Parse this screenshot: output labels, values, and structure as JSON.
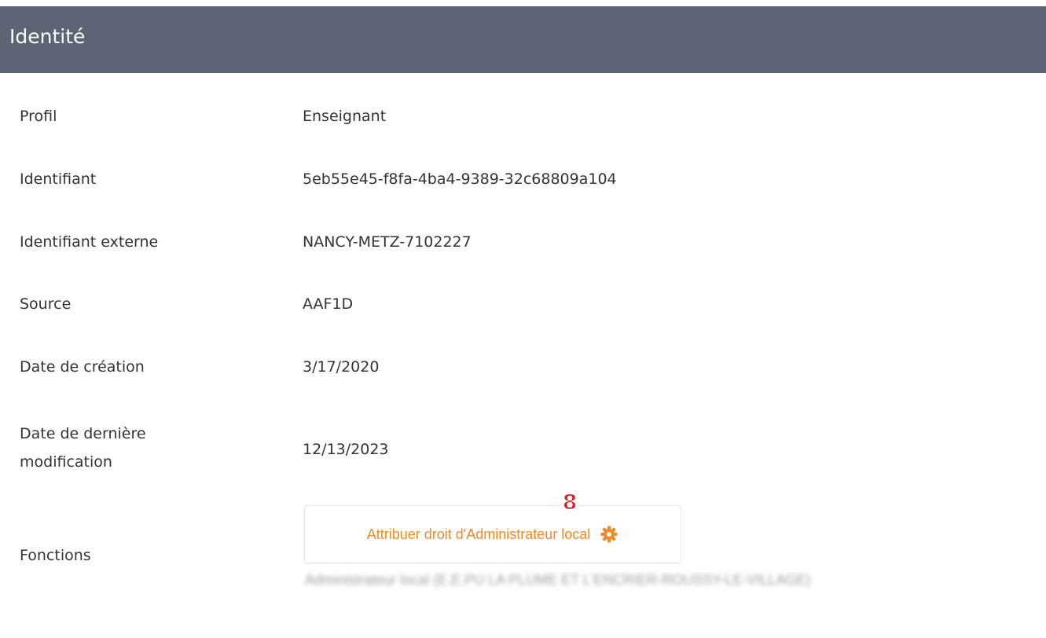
{
  "panel": {
    "title": "Identité"
  },
  "fields": {
    "profil": {
      "label": "Profil",
      "value": "Enseignant"
    },
    "identifiant": {
      "label": "Identifiant",
      "value": "5eb55e45-f8fa-4ba4-9389-32c68809a104"
    },
    "identifiant_externe": {
      "label": "Identifiant externe",
      "value": "NANCY-METZ-7102227"
    },
    "source": {
      "label": "Source",
      "value": "AAF1D"
    },
    "date_creation": {
      "label": "Date de création",
      "value": "3/17/2020"
    },
    "date_modification": {
      "label_line1": "Date de dernière",
      "label_line2": "modification",
      "value": "12/13/2023"
    },
    "fonctions": {
      "label": "Fonctions"
    }
  },
  "actions": {
    "assign_admin_label": "Attribuer droit d'Administrateur local",
    "icon": "gear-icon",
    "accent_color": "#f08a24"
  },
  "annotation": {
    "step_number": "8",
    "color": "#e4161b"
  },
  "blurred_function_text": "Administrateur local (E.E.PU LA PLUME ET L'ENCRIER-ROUSSY-LE-VILLAGE)",
  "colors": {
    "header_bg": "#5c6573",
    "text": "#333333"
  }
}
